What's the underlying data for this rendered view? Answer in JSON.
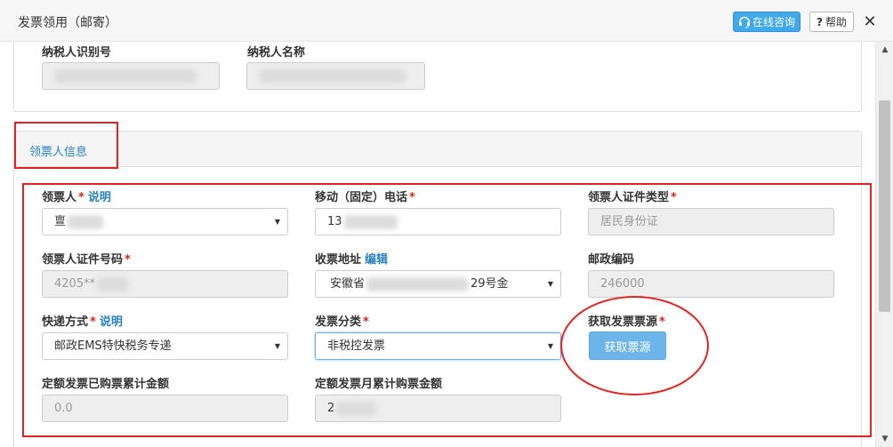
{
  "window": {
    "title": "发票领用（邮寄）",
    "online_button": "在线咨询",
    "help_button": "帮助",
    "close_symbol": "✕"
  },
  "taxpayer": {
    "id_label": "纳税人识别号",
    "name_label": "纳税人名称"
  },
  "section": {
    "title": "领票人信息"
  },
  "form": {
    "receiver_label": "领票人",
    "receiver_link": "说明",
    "receiver_value": "亶",
    "phone_label": "移动（固定）电话",
    "phone_value": "13",
    "id_type_label": "领票人证件类型",
    "id_type_value": "居民身份证",
    "id_no_label": "领票人证件号码",
    "id_no_value": "4205**",
    "address_label": "收票地址",
    "address_link": "编辑",
    "address_value_start": "安徽省",
    "address_value_end": "29号金",
    "postcode_label": "邮政编码",
    "postcode_value": "246000",
    "delivery_label": "快递方式",
    "delivery_link": "说明",
    "delivery_value": "邮政EMS特快税务专递",
    "invoice_type_label": "发票分类",
    "invoice_type_value": "非税控发票",
    "source_label": "获取发票票源",
    "source_button": "获取票源",
    "quota_total_label": "定额发票已购票累计金额",
    "quota_total_value": "0.0",
    "quota_month_label": "定额发票月累计购票金额",
    "quota_month_value": "2",
    "required_mark": "*"
  },
  "icons": {
    "headset": "headset-icon",
    "help": "question-icon",
    "close": "close-icon",
    "dropdown": "chevron-down-icon"
  },
  "colors": {
    "accent": "#2a7fbf",
    "button_blue": "#3fa9e9",
    "required": "#d9261c",
    "annotation": "#e52222"
  }
}
